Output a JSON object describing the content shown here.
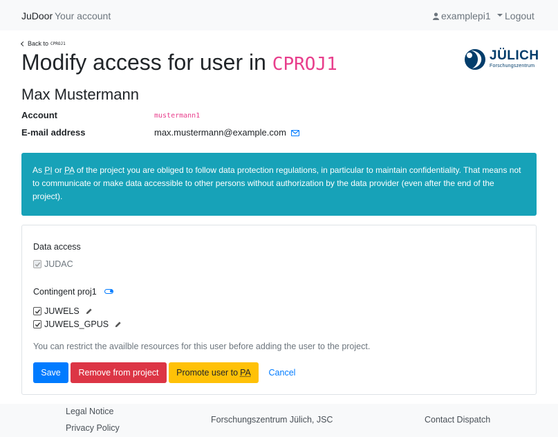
{
  "navbar": {
    "brand": "JuDoor",
    "your_account": "Your account",
    "user": "examplepi1",
    "logout": "Logout"
  },
  "header": {
    "back_prefix": "Back to",
    "back_project": "CPROJ1",
    "title_prefix": "Modify access for user in",
    "project_code": "CPROJ1",
    "logo_text": "JÜLICH",
    "logo_sub": "Forschungszentrum"
  },
  "user": {
    "name": "Max Mustermann",
    "account_label": "Account",
    "account_value": "mustermann1",
    "email_label": "E-mail address",
    "email_value": "max.mustermann@example.com"
  },
  "alert": {
    "part1": "As",
    "pi": "PI",
    "or": "or",
    "pa": "PA",
    "part2": "of the project you are obliged to follow data protection regulations, in particular to maintain confidentiality. That means not to communicate or make data accessible to other persons without authorization by the data provider (even after the end of the project)."
  },
  "access": {
    "data_access_label": "Data access",
    "judac": "JUDAC",
    "contingent_label": "Contingent proj1",
    "juwels": "JUWELS",
    "juwels_gpus": "JUWELS_GPUS",
    "help": "You can restrict the availble resources for this user before adding the user to the project."
  },
  "buttons": {
    "save": "Save",
    "remove": "Remove from project",
    "promote_prefix": "Promote user to",
    "promote_pa": "PA",
    "cancel": "Cancel"
  },
  "footer": {
    "legal": "Legal Notice",
    "privacy": "Privacy Policy",
    "org": "Forschungszentrum Jülich, JSC",
    "contact": "Contact Dispatch"
  },
  "colors": {
    "accent": "#007bff",
    "danger": "#dc3545",
    "warning": "#ffc107",
    "info": "#17a2b8",
    "code": "#e83e8c"
  }
}
